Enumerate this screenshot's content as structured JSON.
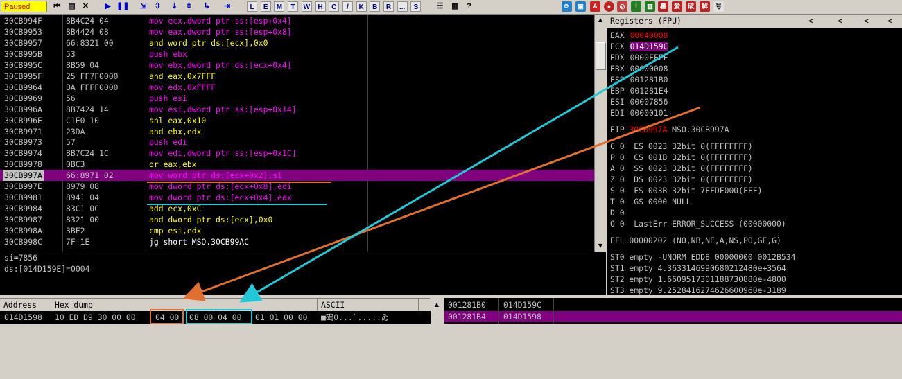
{
  "toolbar": {
    "status": "Paused",
    "letter_buttons": [
      "L",
      "E",
      "M",
      "T",
      "W",
      "H",
      "C",
      "/",
      "K",
      "B",
      "R",
      "...",
      "S"
    ],
    "right_icons": [
      "A",
      "I",
      "暑",
      "爱",
      "破",
      "解",
      "号"
    ]
  },
  "disasm": {
    "rows": [
      {
        "addr": "30CB994F",
        "hex": "8B4C24 04",
        "ins": "mov ecx,dword ptr ss:[esp+0x4]",
        "kind": "mov"
      },
      {
        "addr": "30CB9953",
        "hex": "8B4424 08",
        "ins": "mov eax,dword ptr ss:[esp+0x8]",
        "kind": "mov"
      },
      {
        "addr": "30CB9957",
        "hex": "66:8321 00",
        "ins": "and word ptr ds:[ecx],0x0",
        "kind": "and"
      },
      {
        "addr": "30CB995B",
        "hex": "53",
        "ins": "push ebx",
        "kind": "push"
      },
      {
        "addr": "30CB995C",
        "hex": "8B59 04",
        "ins": "mov ebx,dword ptr ds:[ecx+0x4]",
        "kind": "mov"
      },
      {
        "addr": "30CB995F",
        "hex": "25 FF7F0000",
        "ins": "and eax,0x7FFF",
        "kind": "and"
      },
      {
        "addr": "30CB9964",
        "hex": "BA FFFF0000",
        "ins": "mov edx,0xFFFF",
        "kind": "mov"
      },
      {
        "addr": "30CB9969",
        "hex": "56",
        "ins": "push esi",
        "kind": "push"
      },
      {
        "addr": "30CB996A",
        "hex": "8B7424 14",
        "ins": "mov esi,dword ptr ss:[esp+0x14]",
        "kind": "mov"
      },
      {
        "addr": "30CB996E",
        "hex": "C1E0 10",
        "ins": "shl eax,0x10",
        "kind": "shl"
      },
      {
        "addr": "30CB9971",
        "hex": "23DA",
        "ins": "and ebx,edx",
        "kind": "and"
      },
      {
        "addr": "30CB9973",
        "hex": "57",
        "ins": "push edi",
        "kind": "push"
      },
      {
        "addr": "30CB9974",
        "hex": "8B7C24 1C",
        "ins": "mov edi,dword ptr ss:[esp+0x1C]",
        "kind": "mov"
      },
      {
        "addr": "30CB9978",
        "hex": "0BC3",
        "ins": "or eax,ebx",
        "kind": "or"
      },
      {
        "addr": "30CB997A",
        "hex": "66:8971 02",
        "ins": "mov word ptr ds:[ecx+0x2],si",
        "kind": "mov",
        "selected": true
      },
      {
        "addr": "30CB997E",
        "hex": "8979 08",
        "ins": "mov dword ptr ds:[ecx+0x8],edi",
        "kind": "mov"
      },
      {
        "addr": "30CB9981",
        "hex": "8941 04",
        "ins": "mov dword ptr ds:[ecx+0x4],eax",
        "kind": "mov"
      },
      {
        "addr": "30CB9984",
        "hex": "83C1 0C",
        "ins": "add ecx,0xC",
        "kind": "add"
      },
      {
        "addr": "30CB9987",
        "hex": "8321 00",
        "ins": "and dword ptr ds:[ecx],0x0",
        "kind": "and"
      },
      {
        "addr": "30CB998A",
        "hex": "3BF2",
        "ins": "cmp esi,edx",
        "kind": "cmp"
      },
      {
        "addr": "30CB998C",
        "hex": "7F 1E",
        "ins": "jg short MSO.30CB99AC",
        "kind": "jg"
      }
    ]
  },
  "info": {
    "line1": "si=7856",
    "line2": "ds:[014D159E]=0004"
  },
  "registers": {
    "title": "Registers (FPU)",
    "gp": [
      {
        "name": "EAX",
        "value": "00040008",
        "changed": true
      },
      {
        "name": "ECX",
        "value": "014D159C",
        "highlight": true
      },
      {
        "name": "EDX",
        "value": "0000FFFF"
      },
      {
        "name": "EBX",
        "value": "00000008"
      },
      {
        "name": "ESP",
        "value": "001281B0"
      },
      {
        "name": "EBP",
        "value": "001281E4"
      },
      {
        "name": "ESI",
        "value": "00007856"
      },
      {
        "name": "EDI",
        "value": "00000101"
      }
    ],
    "eip": {
      "name": "EIP",
      "value": "30CB997A",
      "comment": "MSO.30CB997A"
    },
    "flags": [
      "C 0  ES 0023 32bit 0(FFFFFFFF)",
      "P 0  CS 001B 32bit 0(FFFFFFFF)",
      "A 0  SS 0023 32bit 0(FFFFFFFF)",
      "Z 0  DS 0023 32bit 0(FFFFFFFF)",
      "S 0  FS 003B 32bit 7FFDF000(FFF)",
      "T 0  GS 0000 NULL",
      "D 0",
      "O 0  LastErr ERROR_SUCCESS (00000000)"
    ],
    "efl": "EFL 00000202 (NO,NB,NE,A,NS,PO,GE,G)",
    "fpu": [
      "ST0 empty -UNORM EDD8 00000000 0012B534",
      "ST1 empty 4.3633146990680212480e+3564",
      "ST2 empty 1.6609517301188730880e-4800",
      "ST3 empty 9.2528416274626600960e-3189"
    ]
  },
  "dump": {
    "headers": {
      "address": "Address",
      "hex": "Hex dump",
      "ascii": "ASCII"
    },
    "addr": "014D1598",
    "bytes_a": "10 ED D9 30 00 00",
    "bytes_b": "04 00",
    "bytes_c": "08 00 04 00",
    "bytes_d": "01 01 00 00",
    "ascii": "■碣0...`.....ゐ"
  },
  "stack": {
    "rows": [
      {
        "addr": "001281B0",
        "value": "014D159C",
        "selected": false
      },
      {
        "addr": "001281B4",
        "value": "014D1598",
        "selected": true
      }
    ]
  },
  "colors": {
    "mov": "#ff00ff",
    "push": "#ff00ff",
    "and": "#ffff00",
    "or": "#ffff00",
    "shl": "#ffff00",
    "add": "#ffff00",
    "cmp": "#ffff00",
    "jg": "#ffff00",
    "selected_row": "#800080",
    "changed_register": "#ff0000",
    "annotation_orange": "#e07030",
    "annotation_cyan": "#20c8d8"
  }
}
